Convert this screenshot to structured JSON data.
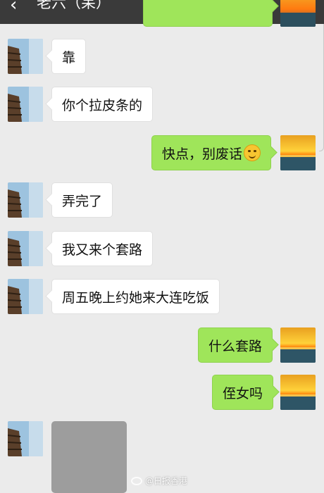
{
  "header": {
    "back_icon": "‹",
    "title": "老六（呆）",
    "more_icon": "more-dots"
  },
  "messages": [
    {
      "side": "in",
      "text": "靠"
    },
    {
      "side": "in",
      "text": "你个拉皮条的"
    },
    {
      "side": "out",
      "text": "快点，别废话",
      "emoji": "smirk-face"
    },
    {
      "side": "in",
      "text": "弄完了"
    },
    {
      "side": "in",
      "text": "我又来个套路"
    },
    {
      "side": "in",
      "text": "周五晚上约她来大连吃饭"
    },
    {
      "side": "out",
      "text": "什么套路"
    },
    {
      "side": "out",
      "text": "侄女吗"
    },
    {
      "side": "in",
      "type": "image"
    }
  ],
  "watermark": {
    "text": "@日报香港"
  },
  "colors": {
    "sent_bubble": "#9fe55a",
    "received_bubble": "#ffffff",
    "chat_bg": "#ebebeb",
    "header_bg": "#3a3a3a"
  }
}
